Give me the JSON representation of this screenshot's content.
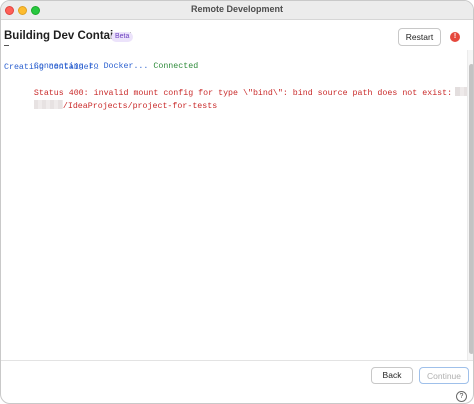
{
  "window": {
    "title": "Remote Development"
  },
  "header": {
    "title": "Building Dev Container",
    "badge": "Beta",
    "restart_label": "Restart",
    "error_icon": "!"
  },
  "log": {
    "lines": [
      {
        "text": "Connecting to Docker... ",
        "status": "Connected"
      },
      {
        "text": "Creating container…"
      },
      {
        "text": "Status 400: invalid mount config for type \\\"bind\\\": bind source path does not exist:"
      },
      {
        "text": "/IdeaProjects/project-for-tests"
      }
    ]
  },
  "footer": {
    "back_label": "Back",
    "continue_label": "Continue",
    "help_label": "?"
  },
  "colors": {
    "log_blue": "#2a5fcf",
    "log_green": "#2e8b3a",
    "log_red": "#c92a2a",
    "badge_text": "#6b3fbf",
    "badge_bg": "#ece3fb",
    "error_indicator": "#e5483d",
    "focus_ring": "#9fc0ea"
  },
  "icons": {
    "close": "traffic-light-close-icon",
    "minimize": "traffic-light-minimize-icon",
    "maximize": "traffic-light-maximize-icon",
    "error": "error-indicator-icon",
    "help": "help-icon"
  }
}
